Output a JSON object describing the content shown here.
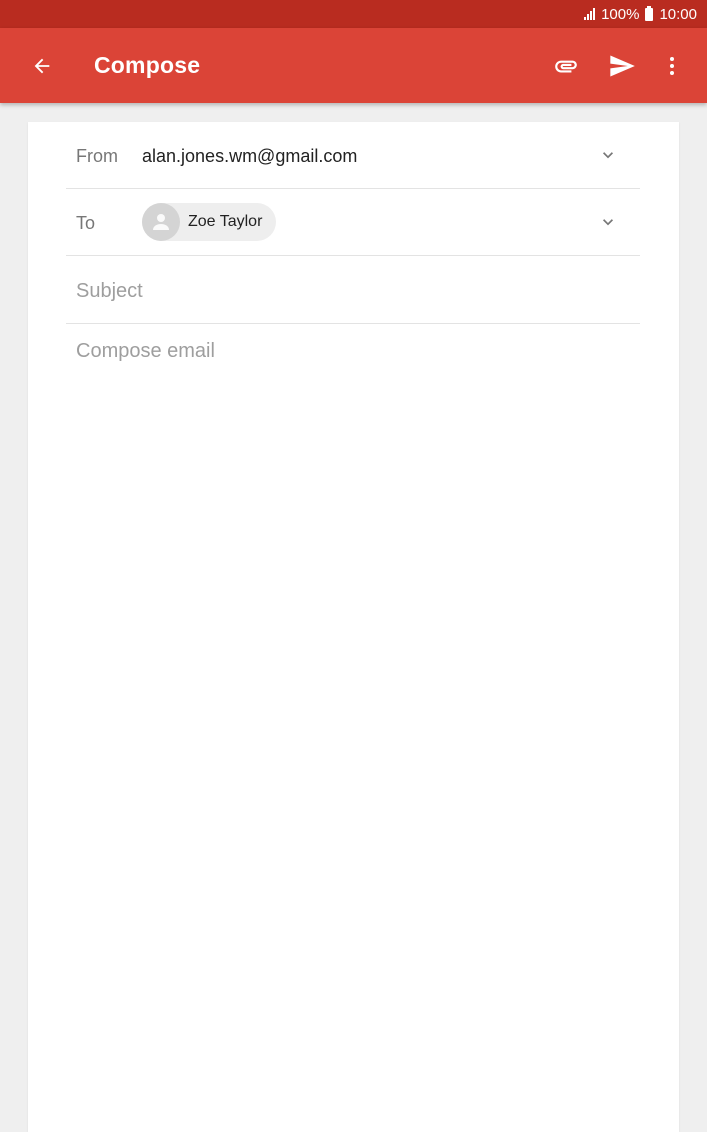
{
  "status_bar": {
    "battery_text": "100%",
    "time": "10:00",
    "signal_icon": "signal-icon",
    "battery_icon": "battery-icon"
  },
  "app_bar": {
    "title": "Compose",
    "back_icon": "arrow-back-icon",
    "attach_icon": "paperclip-icon",
    "send_icon": "send-icon",
    "more_icon": "more-vert-icon",
    "color": "#db4437",
    "status_color": "#b92c20"
  },
  "compose": {
    "from_label": "From",
    "from_value": "alan.jones.wm@gmail.com",
    "to_label": "To",
    "to_recipient": "Zoe Taylor",
    "subject_placeholder": "Subject",
    "body_placeholder": "Compose email"
  }
}
